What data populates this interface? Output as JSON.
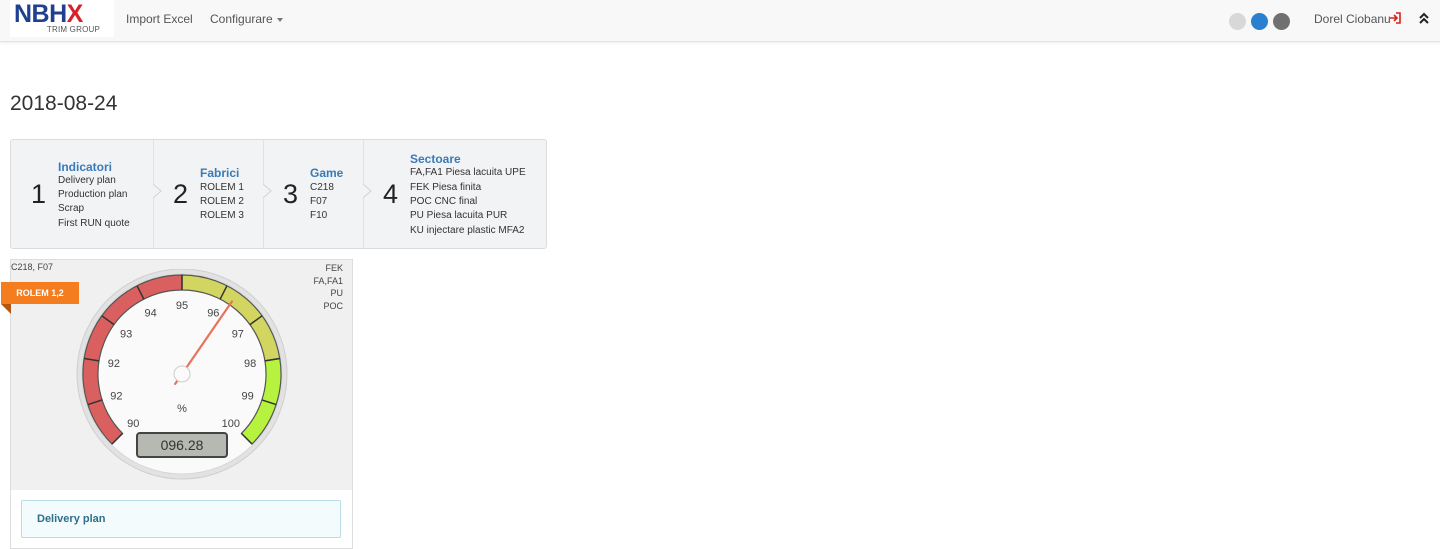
{
  "brand": {
    "name_main": "NBH",
    "name_accent": "X",
    "subtitle": "TRIM GROUP"
  },
  "nav": {
    "links": [
      "Import Excel",
      "Configurare"
    ],
    "theme_dots": [
      "#d8d8d8",
      "#2a7fd1",
      "#707070"
    ],
    "user": "Dorel Ciobanu",
    "logout_icon": "sign-out-icon",
    "collapse_icon": "double-chevron-up-icon"
  },
  "page": {
    "title": "2018-08-24"
  },
  "steps": [
    {
      "num": "1",
      "title": "Indicatori",
      "items": [
        "Delivery plan",
        "Production plan",
        "Scrap",
        "First RUN quote"
      ]
    },
    {
      "num": "2",
      "title": "Fabrici",
      "items": [
        "ROLEM 1",
        "ROLEM 2",
        "ROLEM 3"
      ]
    },
    {
      "num": "3",
      "title": "Game",
      "items": [
        "C218",
        "F07",
        "F10"
      ]
    },
    {
      "num": "4",
      "title": "Sectoare",
      "items": [
        "FA,FA1 Piesa lacuita UPE",
        "FEK Piesa finita",
        "POC CNC final",
        "PU Piesa lacuita PUR",
        "KU injectare plastic MFA2"
      ]
    }
  ],
  "gauge_panel": {
    "corner_left": "C218, F07",
    "corner_right": [
      "FEK",
      "FA,FA1",
      "PU",
      "POC"
    ],
    "ribbon": "ROLEM 1,2",
    "gauge": {
      "min": 90,
      "max": 100,
      "tick_labels": [
        "90",
        "92",
        "92",
        "93",
        "94",
        "95",
        "96",
        "97",
        "98",
        "99",
        "100"
      ],
      "unit": "%",
      "value": 96.28,
      "readout": "096.28",
      "bands": [
        {
          "from": 90,
          "to": 95,
          "color": "#d9605e"
        },
        {
          "from": 95,
          "to": 98,
          "color": "#d2d660"
        },
        {
          "from": 98,
          "to": 100,
          "color": "#b6f23e"
        }
      ]
    },
    "button": "Delivery plan"
  }
}
